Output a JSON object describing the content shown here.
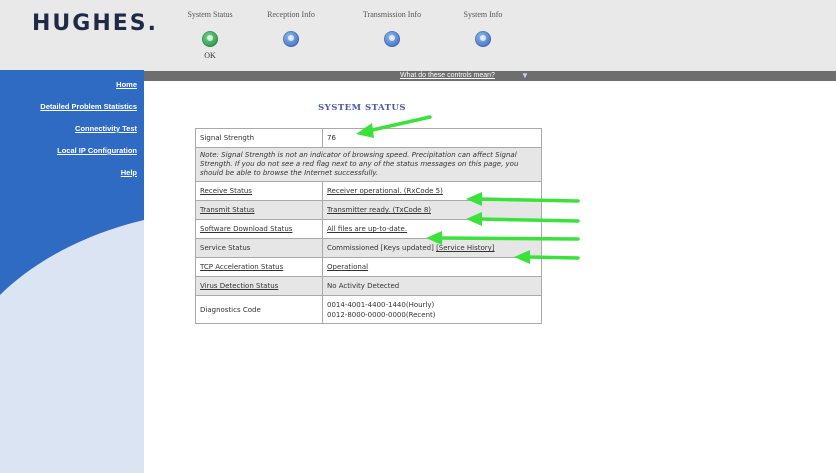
{
  "brand": {
    "logo": "HUGHES."
  },
  "header": {
    "items": [
      {
        "label": "System Status",
        "state": "OK",
        "color": "#1d8a3c"
      },
      {
        "label": "Reception Info",
        "color": "#2c63b8"
      },
      {
        "label": "Transmission Info",
        "color": "#2c63b8"
      },
      {
        "label": "System Info",
        "color": "#2c63b8"
      }
    ]
  },
  "sidebar": {
    "items": [
      {
        "label": "Home"
      },
      {
        "label": "Detailed Problem Statistics"
      },
      {
        "label": "Connectivity Test"
      },
      {
        "label": "Local IP Configuration"
      },
      {
        "label": "Help"
      }
    ]
  },
  "strip": {
    "link": "What do these controls mean?",
    "icon": "chevron-down-icon"
  },
  "main": {
    "title": "SYSTEM STATUS",
    "signal": {
      "label": "Signal Strength",
      "value": "76"
    },
    "note": "Note: Signal Strength is not an indicator of browsing speed. Precipitation can affect Signal Strength. If you do not see a red flag next to any of the status messages on this page, you should be able to browse the Internet successfully.",
    "rows": [
      {
        "label": "Receive Status",
        "value": "Receiver operational. (RxCode 5)"
      },
      {
        "label": "Transmit Status",
        "value": "Transmitter ready. (TxCode 8)"
      },
      {
        "label": "Software Download Status",
        "value": "All files are up-to-date."
      },
      {
        "label": "Service Status",
        "value": "Commissioned [Keys updated]",
        "link": "[Service History]"
      },
      {
        "label": "TCP Acceleration Status",
        "value": "Operational"
      },
      {
        "label": "Virus Detection Status",
        "value": "No Activity Detected"
      }
    ],
    "diagnostics": {
      "label": "Diagnostics Code",
      "line1": "0014-4001-4400-1440(Hourly)",
      "line2": "0012-8000-0000-0000(Recent)"
    }
  },
  "colors": {
    "sidebar": "#2f6bc2",
    "annotation_arrow": "#3ce23c",
    "title": "#4a57a8"
  }
}
